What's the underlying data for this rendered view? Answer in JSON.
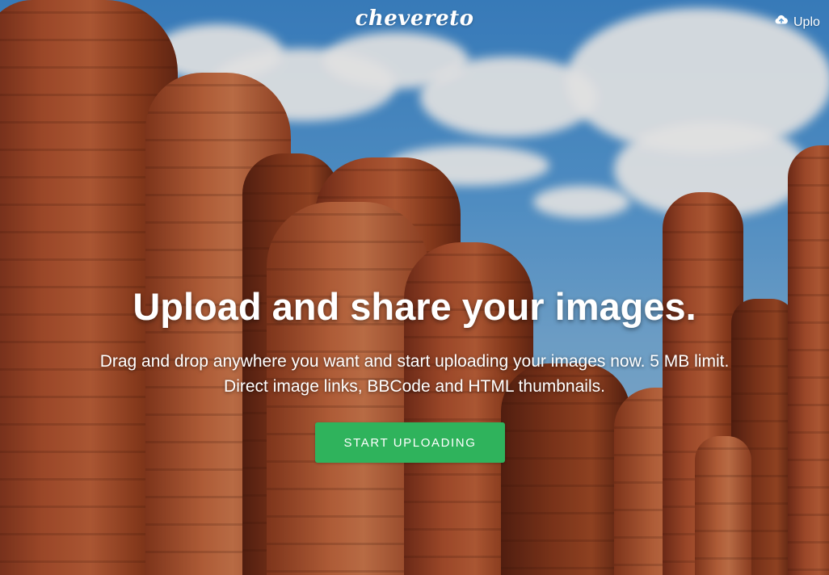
{
  "header": {
    "logo_text": "chevereto",
    "upload_label": "Uplo",
    "upload_icon": "cloud-upload-icon"
  },
  "hero": {
    "title": "Upload and share your images.",
    "description": "Drag and drop anywhere you want and start uploading your images now. 5 MB limit. Direct image links, BBCode and HTML thumbnails.",
    "button_label": "START UPLOADING"
  },
  "colors": {
    "button": "#2fb35c",
    "text": "#ffffff",
    "sky": "#5aa0dc",
    "rock": "#b0512e"
  }
}
